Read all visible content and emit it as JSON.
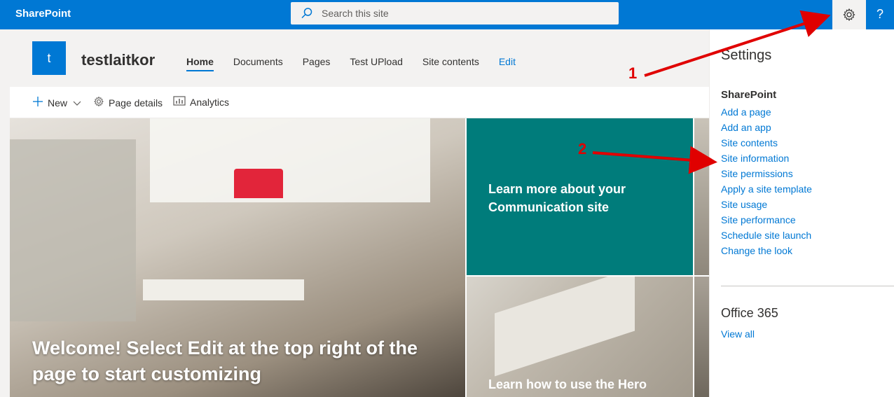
{
  "topbar": {
    "brand": "SharePoint",
    "search_placeholder": "Search this site",
    "help_label": "?"
  },
  "site": {
    "logo_letter": "t",
    "name": "testlaitkor",
    "nav": [
      "Home",
      "Documents",
      "Pages",
      "Test UPload",
      "Site contents",
      "Edit"
    ]
  },
  "commandbar": {
    "new_label": "New",
    "page_details_label": "Page details",
    "analytics_label": "Analytics"
  },
  "hero": {
    "main_caption": "Welcome! Select Edit at the top right of the page to start customizing",
    "tile1_text": "Learn more about your Communication site",
    "tile2_text": "Learn how to use the Hero"
  },
  "settings": {
    "title": "Settings",
    "sharepoint_heading": "SharePoint",
    "links": [
      "Add a page",
      "Add an app",
      "Site contents",
      "Site information",
      "Site permissions",
      "Apply a site template",
      "Site usage",
      "Site performance",
      "Schedule site launch",
      "Change the look"
    ],
    "office_heading": "Office 365",
    "view_all": "View all"
  },
  "annotations": {
    "label1": "1",
    "label2": "2",
    "arrow_color": "#e00000"
  },
  "colors": {
    "brand_blue": "#0078d4",
    "teal_tile": "#007c7b"
  }
}
